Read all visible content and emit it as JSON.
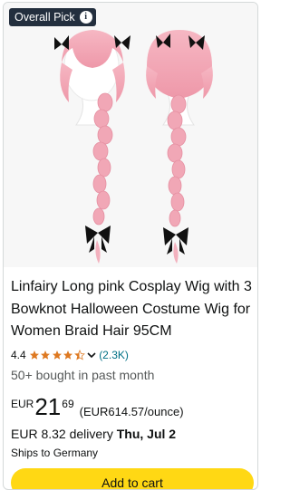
{
  "badge": {
    "label": "Overall Pick",
    "icon": "info-icon"
  },
  "product": {
    "title": "Linfairy Long pink Cosplay Wig with 3 Bowknot Halloween Costume Wig for Women Braid Hair 95CM",
    "image_alt": "pink-braided-wig-product-image"
  },
  "rating": {
    "value": "4.4",
    "stars": 4.4,
    "count": "(2.3K)",
    "colors": {
      "star": "#de7921",
      "link": "#007185"
    }
  },
  "social_proof": "50+ bought in past month",
  "price": {
    "symbol": "EUR",
    "whole": "21",
    "fraction": "69",
    "unit_price": "(EUR614.57/ounce)"
  },
  "delivery": {
    "prefix": "EUR 8.32 delivery",
    "date": "Thu, Jul 2"
  },
  "shipping_note": "Ships to Germany",
  "actions": {
    "add_to_cart": "Add to cart",
    "button_color": "#ffd814"
  }
}
